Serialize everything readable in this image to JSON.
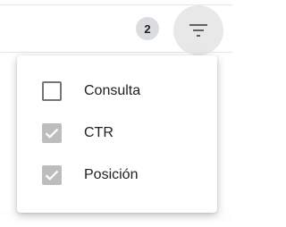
{
  "toolbar": {
    "active_filter_count": "2",
    "filter_icon": "filter-list-icon"
  },
  "background": {
    "row_left_text": "",
    "row_right_text": ""
  },
  "menu": {
    "items": [
      {
        "label": "Consulta",
        "checked": false
      },
      {
        "label": "CTR",
        "checked": true
      },
      {
        "label": "Posición",
        "checked": true
      }
    ]
  },
  "colors": {
    "checkbox_checked": "#bdbdbd",
    "checkbox_border": "#757575",
    "badge_bg": "#dadce0",
    "filter_button_bg": "#e8e8e8"
  }
}
